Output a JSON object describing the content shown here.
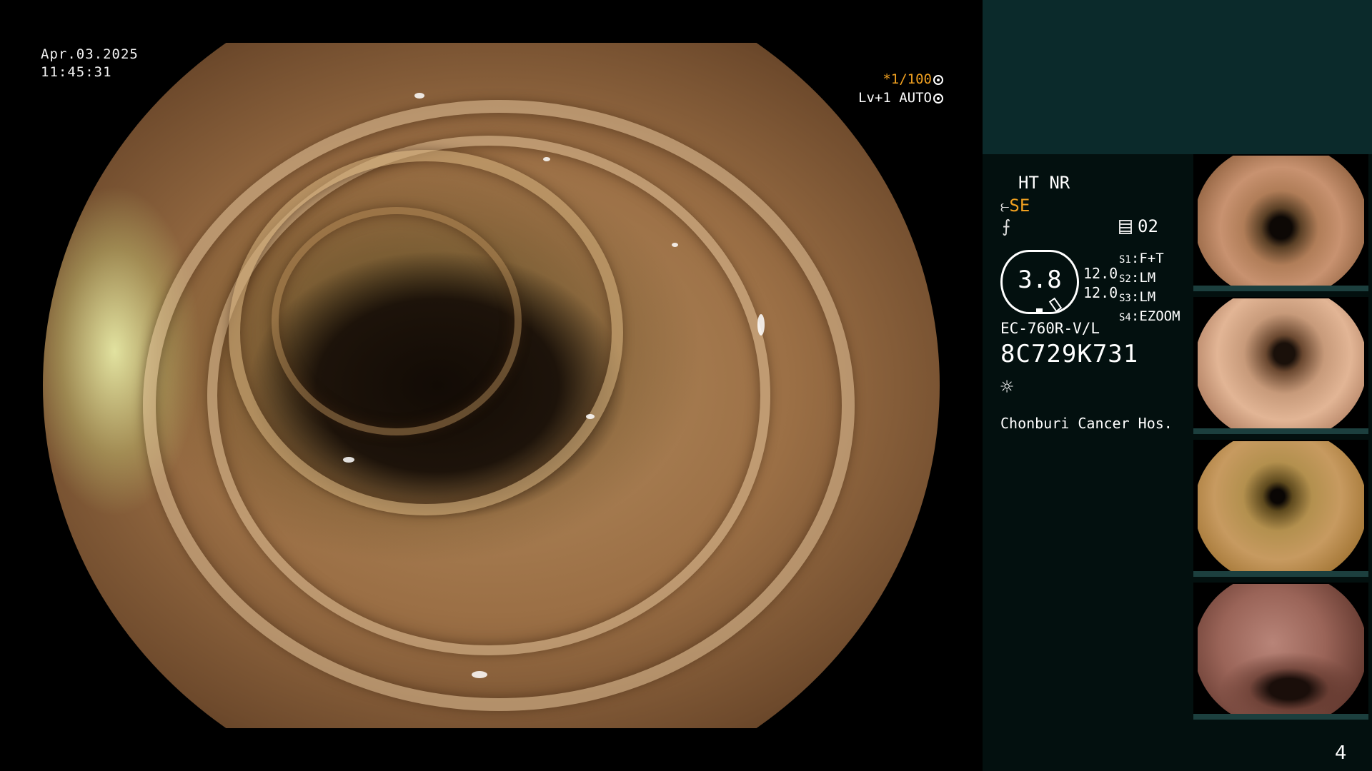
{
  "overlay": {
    "date": "Apr.03.2025",
    "time": "11:45:31",
    "shutter": "*1/100",
    "level_mode": "Lv+1 AUTO"
  },
  "panel": {
    "ht_nr": "HT NR",
    "se_label": "SE",
    "channel": "02",
    "gauge_value": "3.8",
    "levels": [
      "12.0",
      "12.0"
    ],
    "slots": [
      {
        "key": "S1",
        "value": "F+T"
      },
      {
        "key": "S2",
        "value": "LM"
      },
      {
        "key": "S3",
        "value": "LM"
      },
      {
        "key": "S4",
        "value": "EZOOM"
      }
    ],
    "scope_model": "EC-760R-V/L",
    "serial": "8C729K731",
    "hospital": "Chonburi Cancer Hos."
  },
  "thumbnails": [
    {
      "name": "capture-1"
    },
    {
      "name": "capture-2"
    },
    {
      "name": "capture-3"
    },
    {
      "name": "capture-4"
    }
  ],
  "page_number": "4",
  "icons": {
    "shutter": "aperture-icon",
    "level": "iris-icon",
    "enhance": "structure-enhance-icon",
    "freeze": "freeze-icon",
    "channel": "memory-icon",
    "light": "sun-icon"
  }
}
